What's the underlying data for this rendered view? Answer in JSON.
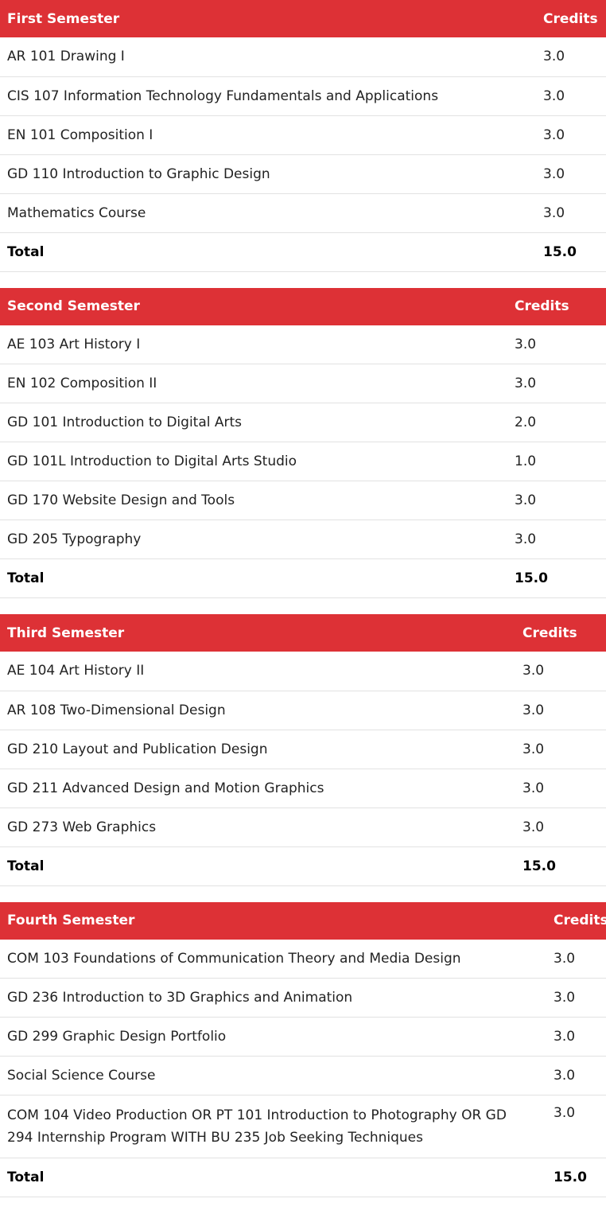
{
  "semesters": [
    {
      "title": "First Semester",
      "credits_label": "Credits",
      "courses": [
        {
          "name": "AR 101 Drawing I",
          "credits": "3.0"
        },
        {
          "name": "CIS 107 Information Technology Fundamentals and Applications",
          "credits": "3.0"
        },
        {
          "name": "EN 101 Composition I",
          "credits": "3.0"
        },
        {
          "name": "GD 110 Introduction to Graphic Design",
          "credits": "3.0"
        },
        {
          "name": "Mathematics Course",
          "credits": "3.0"
        }
      ],
      "total_label": "Total",
      "total": "15.0"
    },
    {
      "title": "Second Semester",
      "credits_label": "Credits",
      "courses": [
        {
          "name": "AE 103 Art History I",
          "credits": "3.0"
        },
        {
          "name": "EN 102 Composition II",
          "credits": "3.0"
        },
        {
          "name": "GD 101 Introduction to Digital Arts",
          "credits": "2.0"
        },
        {
          "name": "GD 101L Introduction to Digital Arts Studio",
          "credits": "1.0"
        },
        {
          "name": "GD 170 Website Design and Tools",
          "credits": "3.0"
        },
        {
          "name": "GD 205 Typography",
          "credits": "3.0"
        }
      ],
      "total_label": "Total",
      "total": "15.0"
    },
    {
      "title": "Third Semester",
      "credits_label": "Credits",
      "courses": [
        {
          "name": "AE 104 Art History II",
          "credits": "3.0"
        },
        {
          "name": "AR 108 Two-Dimensional Design",
          "credits": "3.0"
        },
        {
          "name": "GD 210 Layout and Publication Design",
          "credits": "3.0"
        },
        {
          "name": "GD 211 Advanced Design and Motion Graphics",
          "credits": "3.0"
        },
        {
          "name": "GD 273 Web Graphics",
          "credits": "3.0"
        }
      ],
      "total_label": "Total",
      "total": "15.0"
    },
    {
      "title": "Fourth Semester",
      "credits_label": "Credits",
      "courses": [
        {
          "name": "COM 103 Foundations of Communication Theory and Media Design",
          "credits": "3.0"
        },
        {
          "name": "GD 236 Introduction to 3D Graphics and Animation",
          "credits": "3.0"
        },
        {
          "name": "GD 299 Graphic Design Portfolio",
          "credits": "3.0"
        },
        {
          "name": "Social Science Course",
          "credits": "3.0"
        },
        {
          "name": "COM 104 Video Production OR PT 101 Introduction to Photography OR GD 294 Internship Program WITH BU 235 Job Seeking Techniques",
          "credits": "3.0"
        }
      ],
      "total_label": "Total",
      "total": "15.0"
    }
  ],
  "colors": {
    "header_bg": "#dd3136",
    "header_text": "#ffffff",
    "row_border": "#e2e2e2"
  }
}
